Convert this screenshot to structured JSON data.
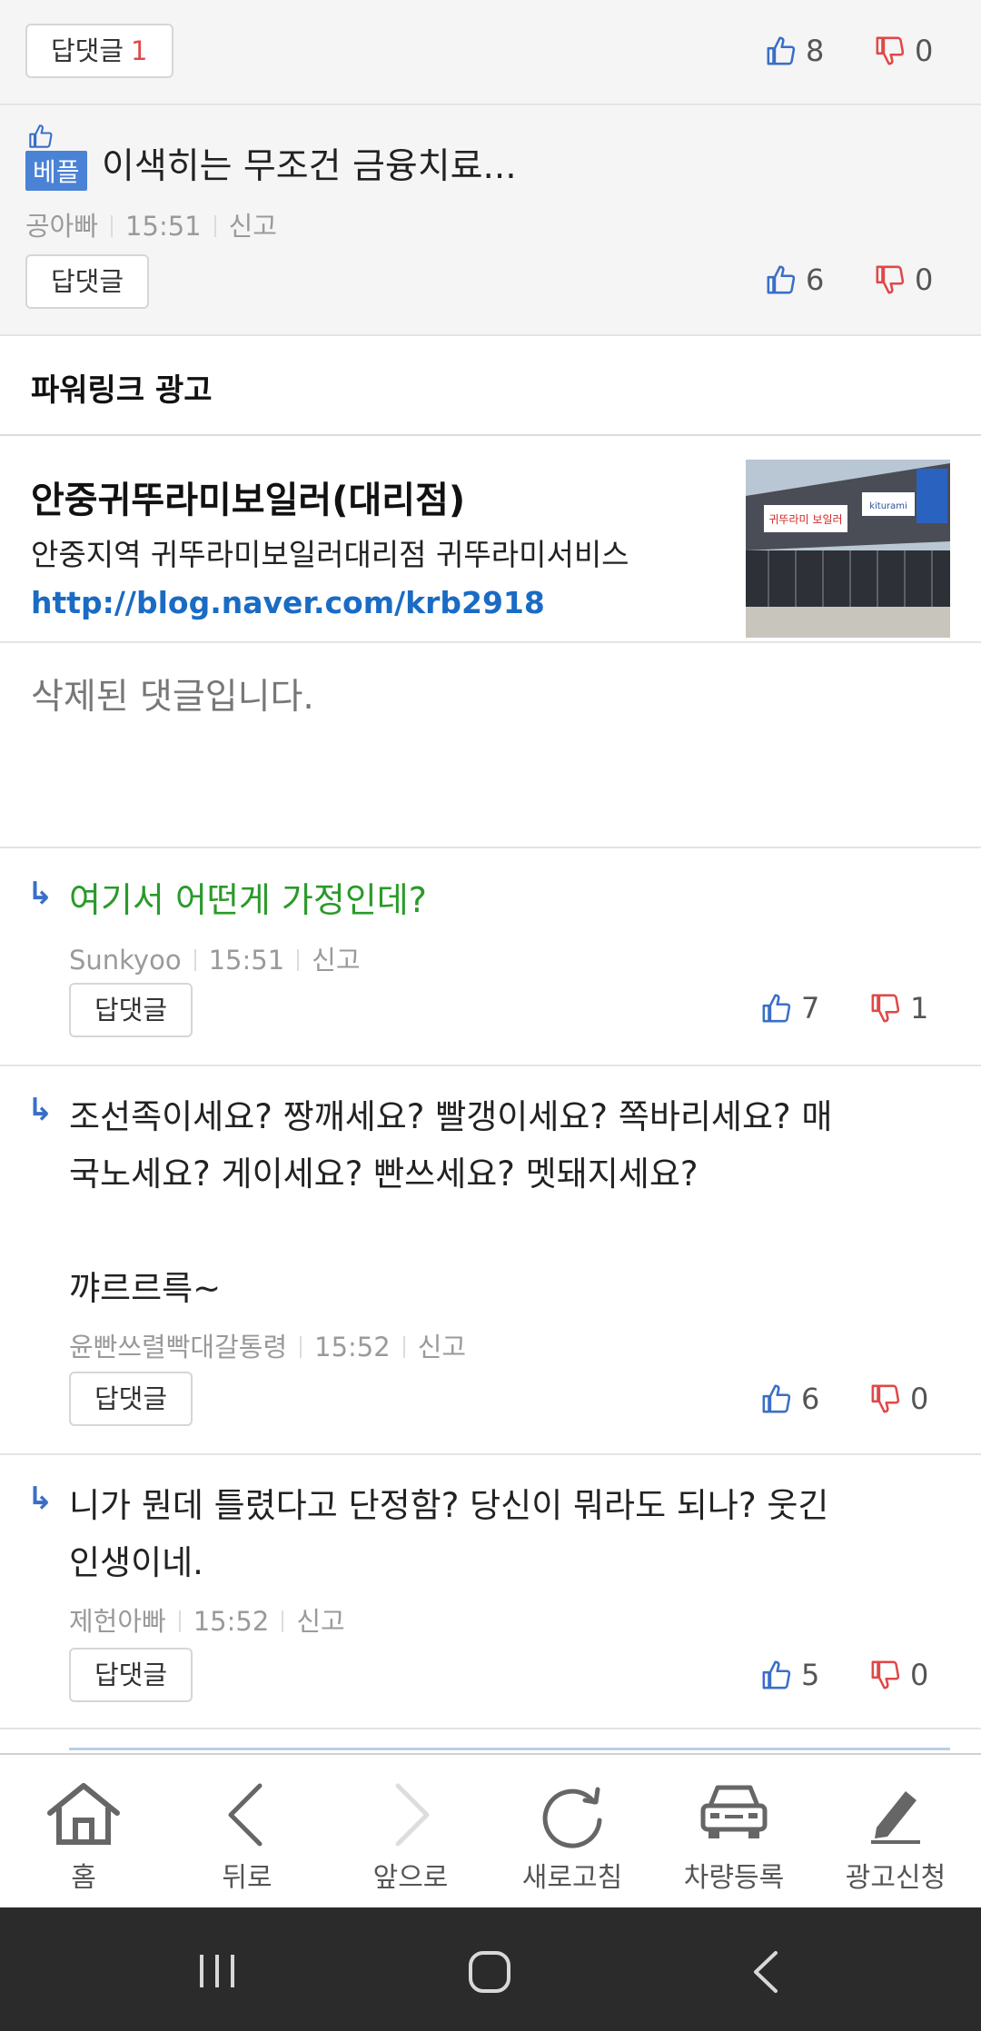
{
  "comments": [
    {
      "reply_label": "답댓글",
      "reply_count": "1",
      "up": "8",
      "down": "0"
    },
    {
      "badge": "베플",
      "text": "이색히는 무조건 금융치료...",
      "author": "공아빠",
      "time": "15:51",
      "report": "신고",
      "reply_label": "답댓글",
      "up": "6",
      "down": "0"
    }
  ],
  "powerlink": {
    "header": "파워링크 광고",
    "title": "안중귀뚜라미보일러(대리점)",
    "desc": "안중지역 귀뚜라미보일러대리점 귀뚜라미서비스",
    "url": "http://blog.naver.com/krb2918",
    "thumb_sign_left": "귀뚜라미 보일러",
    "thumb_sign_right": "kiturami"
  },
  "deleted": "삭제된 댓글입니다.",
  "replies": [
    {
      "text": "여기서 어떤게 가정인데?",
      "author": "Sunkyoo",
      "time": "15:51",
      "report": "신고",
      "reply_label": "답댓글",
      "up": "7",
      "down": "1"
    },
    {
      "line1": "조선족이세요? 짱깨세요? 빨갱이세요? 쪽바리세요? 매",
      "line2": "국노세요? 게이세요? 빤쓰세요? 멧돼지세요?",
      "line3": "꺄르르륵~",
      "author": "윤빤쓰렬빡대갈통령",
      "time": "15:52",
      "report": "신고",
      "reply_label": "답댓글",
      "up": "6",
      "down": "0"
    },
    {
      "line1": "니가 뭔데 틀렸다고 단정함? 당신이 뭐라도 되나? 웃긴",
      "line2": "인생이네.",
      "author": "제헌아빠",
      "time": "15:52",
      "report": "신고",
      "reply_label": "답댓글",
      "up": "5",
      "down": "0"
    }
  ],
  "nav": {
    "home": "홈",
    "back": "뒤로",
    "forward": "앞으로",
    "refresh": "새로고침",
    "car": "차량등록",
    "ad": "광고신청"
  },
  "colors": {
    "like": "#3a6fc7",
    "dislike": "#e04848",
    "reply_text_green": "#2a9a2a",
    "link": "#1a6bc4"
  }
}
